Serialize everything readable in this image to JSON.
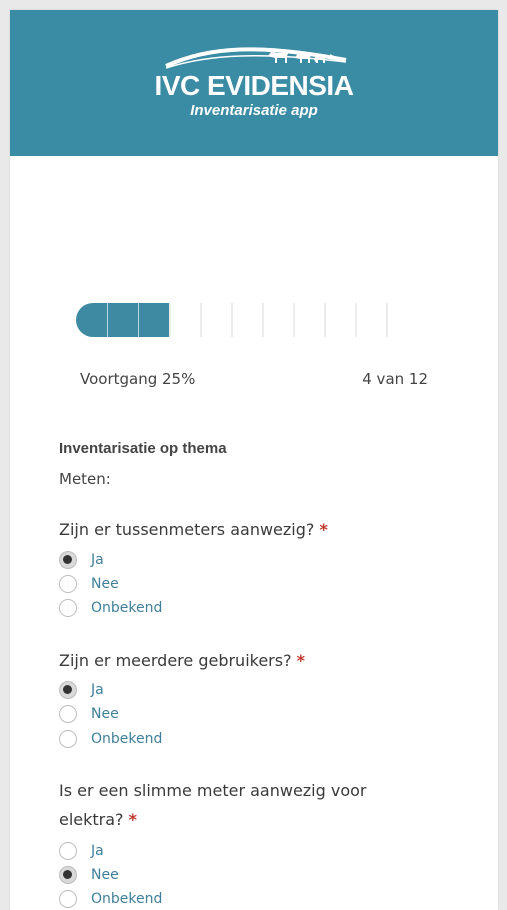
{
  "header": {
    "brand": "IVC EVIDENSIA",
    "subtitle": "Inventarisatie app",
    "background": "#3a8ba4"
  },
  "progress": {
    "label": "Voortgang 25%",
    "percent": 25,
    "count": "4 van 12",
    "current_step": 4,
    "total_steps": 12,
    "fill_color": "#3d8aa2"
  },
  "section": {
    "title": "Inventarisatie op thema",
    "subtitle": "Meten:"
  },
  "questions": [
    {
      "text": "Zijn er tussenmeters aanwezig?",
      "required_mark": "*",
      "options": [
        "Ja",
        "Nee",
        "Onbekend"
      ],
      "selected": "Ja"
    },
    {
      "text": "Zijn er meerdere gebruikers?",
      "required_mark": "*",
      "options": [
        "Ja",
        "Nee",
        "Onbekend"
      ],
      "selected": "Ja"
    },
    {
      "text_line1": "Is er een slimme meter aanwezig voor",
      "text_line2": "elektra?",
      "required_mark": "*",
      "options": [
        "Ja",
        "Nee",
        "Onbekend"
      ],
      "selected": "Nee"
    }
  ]
}
